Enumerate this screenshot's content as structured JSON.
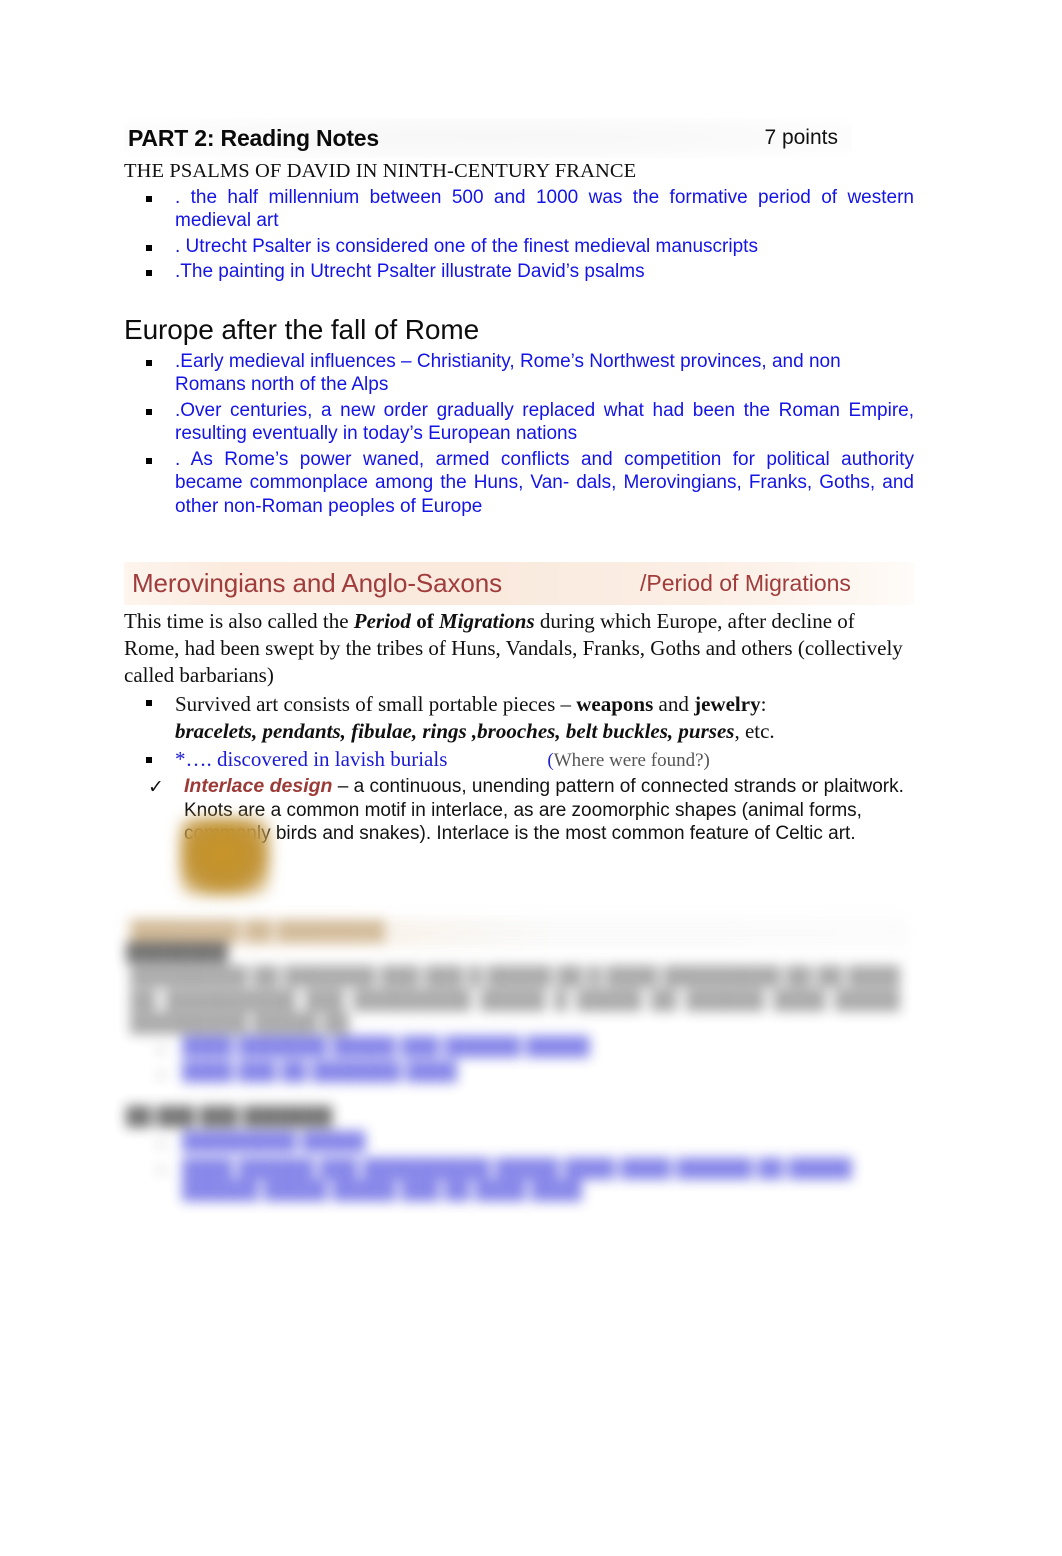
{
  "document": {
    "background_color": "#ffffff",
    "accent_blue": "#1414e6",
    "accent_red": "#a03c3c",
    "band_color": "#faeade"
  },
  "part_header": {
    "title": "PART 2: Reading Notes",
    "points": "7 points"
  },
  "section_psalms": {
    "caps_heading": "THE PSALMS OF DAVID IN NINTH-CENTURY FRANCE",
    "bullets": [
      ".  the half millennium between 500 and 1000 was the formative period of western medieval art",
      ". Utrecht Psalter  is considered one of the finest medieval manuscripts",
      ".The painting in Utrecht Psalter illustrate David’s psalms"
    ]
  },
  "section_europe": {
    "heading": "Europe after the fall of Rome",
    "bullets": [
      ".Early medieval influences – Christianity, Rome’s Northwest provinces, and non Romans north of the Alps",
      ".Over centuries, a new order gradually replaced what had been the Roman Empire, resulting eventually in today’s European nations",
      ".  As Rome’s power waned, armed conflicts and competition for political authority became commonplace among the Huns, Van- dals, Merovingians, Franks, Goths, and other non-Roman peoples of Europe"
    ]
  },
  "section_merovingians": {
    "band_title": "Merovingians and Anglo-Saxons",
    "band_subtitle": "/Period of Migrations",
    "paragraph": {
      "part1": "This time is also called the ",
      "em_period": "Period",
      "em_of": " of ",
      "em_migrations": "Migrations",
      "part2": " during which Europe, after decline of Rome, had been swept by the tribes of Huns, Vandals, Franks, Goths and others (collectively called barbarians)"
    },
    "bullet_survived": {
      "lead": "Survived art consists of small portable pieces – ",
      "bold1": "weapons",
      "mid": " and ",
      "bold2": "jewelry",
      "colon": ":",
      "list_bold_italic": "bracelets, pendants, fibulae, rings ,brooches, belt buckles, purses",
      "tail": ", etc."
    },
    "bullet_burials": {
      "text": "*…. discovered in lavish burials",
      "note_open": "(",
      "note": "Where were found?)"
    },
    "interlace": {
      "check_glyph": "✓",
      "label": "Interlace design",
      "body": " – a continuous, unending pattern of connected strands or plaitwork. Knots are a common motif in interlace, as are zoomorphic shapes (animal forms, commonly birds and snakes). Interlace is the most common feature of Celtic art."
    }
  },
  "artifact_image": {
    "alt": "blurred gold interlace artifact thumbnail",
    "dominant_color": "#c2922f"
  },
  "blurred_lower_section": {
    "note": "content is blurred and illegible in the source image",
    "band_title_placeholder": "████████  ██ ████████",
    "sub_heading_placeholder": "████████",
    "paragraph_placeholder": "█████████ ██ ███████ ███ ███ █ █████ ██ █ ████ █████████ ██ ██ ████ ██ ██████████ ███ █████████ █████ █ █████ ██ ██████ ████ █████ █████████ █████ ██",
    "list_items": [
      "████ ███████ █████ ███ ██████ █████",
      "████ ███ ██ ███████ ████"
    ],
    "second_heading_placeholder": "██ ███ ███ ███████",
    "list_items2": [
      "█████████ █████",
      "████ ██████ ███ ██████████ █████ ████ ████ ██████ ██ █████ ██████ █████ █████ ███ ██ ████ ████"
    ]
  }
}
